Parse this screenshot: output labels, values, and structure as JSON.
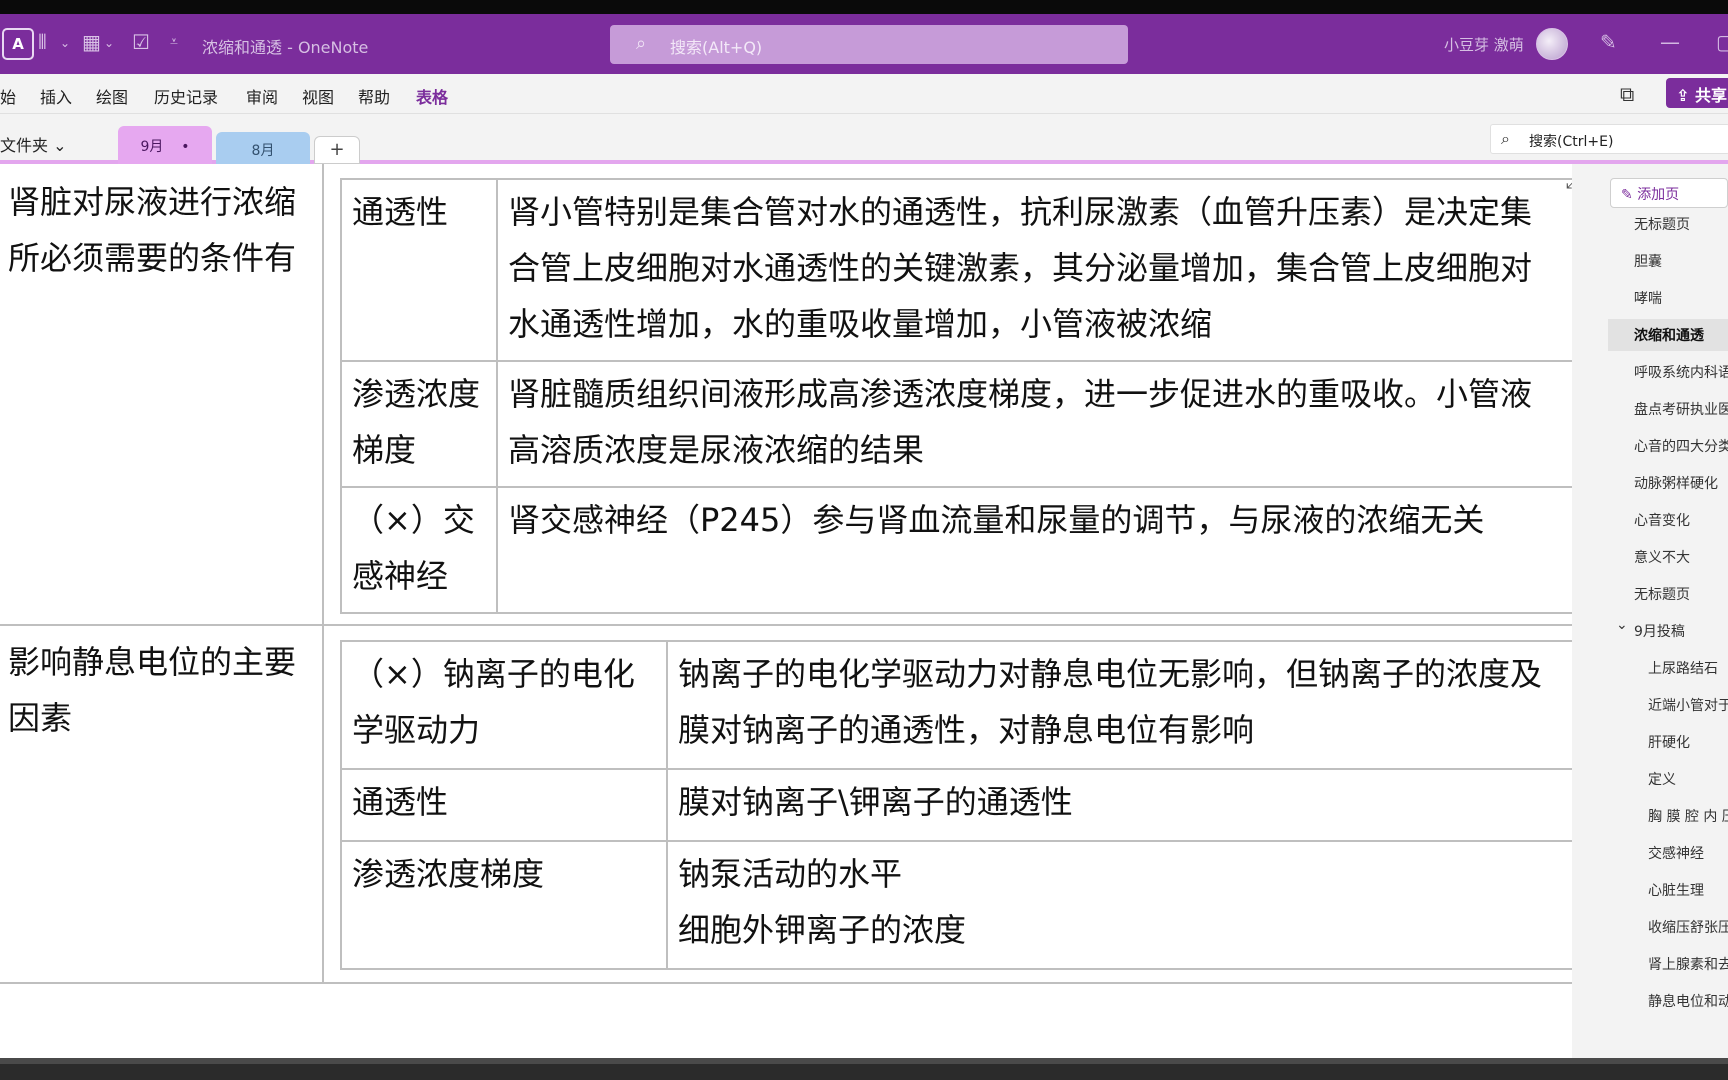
{
  "titlebar": {
    "app_icon": "A",
    "doc_title": "浓缩和通透  -  OneNote",
    "search_placeholder": "搜索(Alt+Q)",
    "user_name": "小豆芽 激萌",
    "qat_icons": [
      "view-icon",
      "table-icon",
      "checkbox-icon",
      "customize-icon"
    ]
  },
  "menu": {
    "items": [
      "始",
      "插入",
      "绘图",
      "历史记录",
      "审阅",
      "视图",
      "帮助",
      "表格"
    ],
    "active": "表格",
    "share_label": "共享"
  },
  "tabs": {
    "folder_label": "文件夹",
    "sections": [
      {
        "label": "9月",
        "color": "#e6a8f0",
        "dot": "•"
      },
      {
        "label": "8月",
        "color": "#a9cdf0"
      }
    ],
    "add_label": "+",
    "page_search_placeholder": "搜索(Ctrl+E)"
  },
  "content": {
    "rows": [
      {
        "label": "肾脏对尿液进行浓缩所必须需要的条件有",
        "items": [
          {
            "key": "通透性",
            "value": "肾小管特别是集合管对水的通透性，抗利尿激素（血管升压素）是决定集合管上皮细胞对水通透性的关键激素，其分泌量增加，集合管上皮细胞对水通透性增加，水的重吸收量增加，小管液被浓缩"
          },
          {
            "key": "渗透浓度梯度",
            "value": "肾脏髓质组织间液形成高渗透浓度梯度，进一步促进水的重吸收。小管液高溶质浓度是尿液浓缩的结果"
          },
          {
            "key": "（×）交感神经",
            "value": "肾交感神经（P245）参与肾血流量和尿量的调节，与尿液的浓缩无关"
          }
        ]
      },
      {
        "label": "影响静息电位的主要因素",
        "items": [
          {
            "key": "（×）钠离子的电化学驱动力",
            "value": "钠离子的电化学驱动力对静息电位无影响，但钠离子的浓度及膜对钠离子的通透性，对静息电位有影响"
          },
          {
            "key": "通透性",
            "value": "膜对钠离子\\钾离子的通透性"
          },
          {
            "key": "渗透浓度梯度",
            "value_lines": [
              "钠泵活动的水平",
              "细胞外钾离子的浓度"
            ]
          }
        ]
      }
    ]
  },
  "pages_panel": {
    "add_page_label": "添加页",
    "pages": [
      {
        "title": "无标题页",
        "level": 1
      },
      {
        "title": "胆囊",
        "level": 1
      },
      {
        "title": "哮喘",
        "level": 1
      },
      {
        "title": "浓缩和通透",
        "level": 1,
        "selected": true
      },
      {
        "title": "呼吸系统内科语",
        "level": 1
      },
      {
        "title": "盘点考研执业医",
        "level": 1
      },
      {
        "title": "心音的四大分类",
        "level": 1
      },
      {
        "title": "动脉粥样硬化",
        "level": 1
      },
      {
        "title": "心音变化",
        "level": 1
      },
      {
        "title": "意义不大",
        "level": 1
      },
      {
        "title": "无标题页",
        "level": 1
      },
      {
        "title": "9月投稿",
        "level": 1,
        "group": true
      },
      {
        "title": "上尿路结石",
        "level": 2
      },
      {
        "title": "近端小管对于",
        "level": 2
      },
      {
        "title": "肝硬化",
        "level": 2
      },
      {
        "title": "定义",
        "level": 2
      },
      {
        "title": "胸 膜 腔 内 压",
        "level": 2
      },
      {
        "title": "交感神经",
        "level": 2
      },
      {
        "title": "心脏生理",
        "level": 2
      },
      {
        "title": "收缩压舒张压",
        "level": 2
      },
      {
        "title": "肾上腺素和去",
        "level": 2
      },
      {
        "title": "静息电位和动",
        "level": 2
      }
    ]
  },
  "colors": {
    "brand": "#7b2d9c",
    "tab_9": "#e6a8f0",
    "tab_8": "#a9cdf0"
  }
}
